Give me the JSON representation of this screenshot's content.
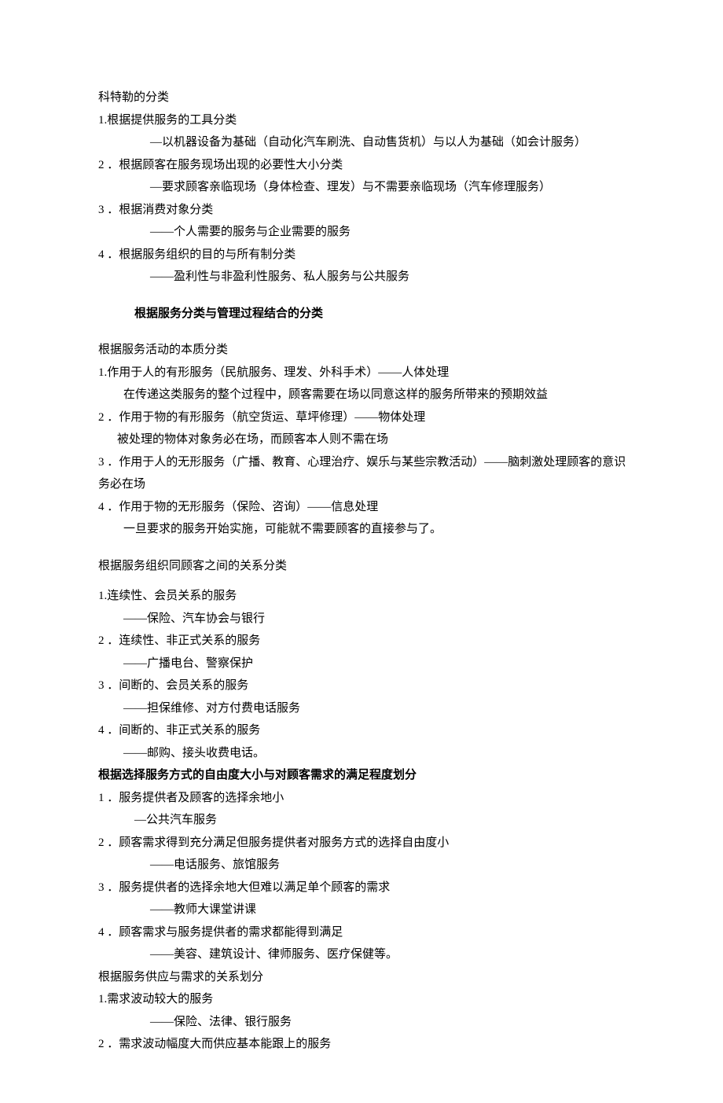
{
  "s0": {
    "title": "科特勒的分类",
    "i1a": "1.根据提供服务的工具分类",
    "i1b": "—以机器设备为基础（自动化汽车刷洗、自动售货机）与以人为基础（如会计服务）",
    "i2a": "2 ．根据顾客在服务现场出现的必要性大小分类",
    "i2b": "—要求顾客亲临现场（身体检查、理发）与不需要亲临现场（汽车修理服务）",
    "i3a": "3 ．根据消费对象分类",
    "i3b": "——个人需要的服务与企业需要的服务",
    "i4a": "4 ．根据服务组织的目的与所有制分类",
    "i4b": "——盈利性与非盈利性服务、私人服务与公共服务"
  },
  "h1": "根据服务分类与管理过程结合的分类",
  "s1": {
    "title": "根据服务活动的本质分类",
    "i1a": "1.作用于人的有形服务（民航服务、理发、外科手术）——人体处理",
    "i1b": "在传递这类服务的整个过程中，顾客需要在场以同意这样的服务所带来的预期效益",
    "i2a": "2 ．作用于物的有形服务（航空货运、草坪修理）——物体处理",
    "i2b": "被处理的物体对象务必在场，而顾客本人则不需在场",
    "i3a": "3 ．作用于人的无形服务（广播、教育、心理治疗、娱乐与某些宗教活动）——脑刺激处理顾客的意识务必在场",
    "i4a": "4 ．作用于物的无形服务（保险、咨询）——信息处理",
    "i4b": "一旦要求的服务开始实施，可能就不需要顾客的直接参与了。"
  },
  "s2": {
    "title": "根据服务组织同顾客之间的关系分类",
    "i1a": "1.连续性、会员关系的服务",
    "i1b": "——保险、汽车协会与银行",
    "i2a": "2 ．连续性、非正式关系的服务",
    "i2b": "——广播电台、警察保护",
    "i3a": "3 ．间断的、会员关系的服务",
    "i3b": "——担保维修、对方付费电话服务",
    "i4a": "4 ．间断的、非正式关系的服务",
    "i4b": "——邮购、接头收费电话。"
  },
  "s3": {
    "title": "根据选择服务方式的自由度大小与对顾客需求的满足程度划分",
    "i1a": "1 ．服务提供者及顾客的选择余地小",
    "i1b": "—公共汽车服务",
    "i2a": "2 ．顾客需求得到充分满足但服务提供者对服务方式的选择自由度小",
    "i2b": "——电话服务、旅馆服务",
    "i3a": "3 ．服务提供者的选择余地大但难以满足单个顾客的需求",
    "i3b": "——教师大课堂讲课",
    "i4a": "4 ．顾客需求与服务提供者的需求都能得到满足",
    "i4b": "——美容、建筑设计、律师服务、医疗保健等。"
  },
  "s4": {
    "title": "根据服务供应与需求的关系划分",
    "i1a": "1.需求波动较大的服务",
    "i1b": "——保险、法律、银行服务",
    "i2a": "2 ．需求波动幅度大而供应基本能跟上的服务"
  }
}
